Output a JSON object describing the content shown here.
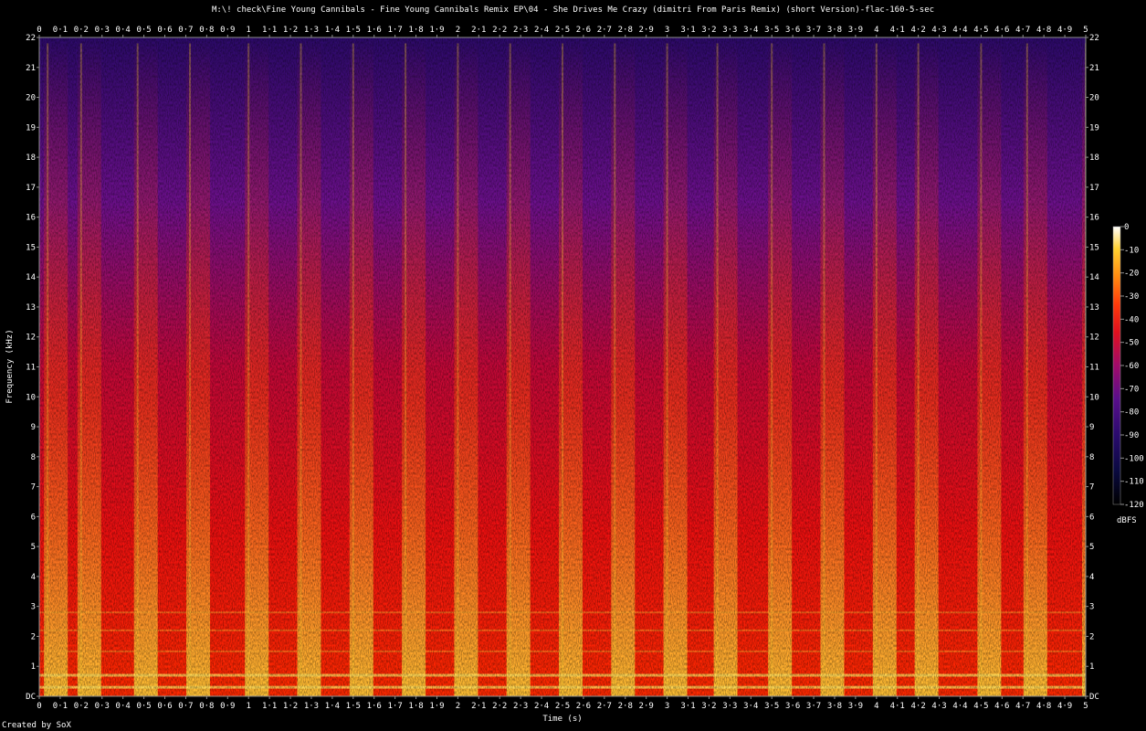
{
  "title": "M:\\! check\\Fine Young Cannibals - Fine Young Cannibals Remix EP\\04 - She Drives Me Crazy (dimitri From Paris Remix) (short Version)-flac-160-5-sec",
  "credit": "Created by SoX",
  "colors": {
    "background": "#000000",
    "axis": "#8f8f8f",
    "text": "#ffffff",
    "palette": [
      "#000000",
      "#0a0a40",
      "#2a0b6e",
      "#5a0f8c",
      "#8a0c80",
      "#b8084e",
      "#e0101e",
      "#ff3a0a",
      "#ff8a10",
      "#ffd030",
      "#ffff90",
      "#ffffff"
    ]
  },
  "chart_data": {
    "type": "heatmap",
    "title": "M:\\! check\\Fine Young Cannibals - Fine Young Cannibals Remix EP\\04 - She Drives Me Crazy (dimitri From Paris Remix) (short Version)-flac-160-5-sec",
    "xlabel": "Time (s)",
    "ylabel": "Frequency (kHz)",
    "xlim": [
      0,
      5
    ],
    "ylim": [
      0,
      22
    ],
    "x_ticks": [
      "0",
      "0·1",
      "0·2",
      "0·3",
      "0·4",
      "0·5",
      "0·6",
      "0·7",
      "0·8",
      "0·9",
      "1",
      "1·1",
      "1·2",
      "1·3",
      "1·4",
      "1·5",
      "1·6",
      "1·7",
      "1·8",
      "1·9",
      "2",
      "2·1",
      "2·2",
      "2·3",
      "2·4",
      "2·5",
      "2·6",
      "2·7",
      "2·8",
      "2·9",
      "3",
      "3·1",
      "3·2",
      "3·3",
      "3·4",
      "3·5",
      "3·6",
      "3·7",
      "3·8",
      "3·9",
      "4",
      "4·1",
      "4·2",
      "4·3",
      "4·4",
      "4·5",
      "4·6",
      "4·7",
      "4·8",
      "4·9",
      "5"
    ],
    "y_ticks": [
      "DC",
      "1",
      "2",
      "3",
      "4",
      "5",
      "6",
      "7",
      "8",
      "9",
      "10",
      "11",
      "12",
      "13",
      "14",
      "15",
      "16",
      "17",
      "18",
      "19",
      "20",
      "21",
      "22"
    ],
    "colorbar": {
      "label": "dBFS",
      "range": [
        -120,
        0
      ],
      "ticks": [
        "0",
        "-10",
        "-20",
        "-30",
        "-40",
        "-50",
        "-60",
        "-70",
        "-80",
        "-90",
        "-100",
        "-110",
        "-120"
      ]
    },
    "onsets_s": [
      0.04,
      0.2,
      0.47,
      0.72,
      1.0,
      1.25,
      1.5,
      1.75,
      2.0,
      2.25,
      2.5,
      2.75,
      3.0,
      3.24,
      3.5,
      3.75,
      4.0,
      4.2,
      4.5,
      4.72,
      5.0
    ],
    "sustained_bands_khz": [
      0.3,
      0.7,
      1.5,
      2.2,
      2.8
    ]
  }
}
